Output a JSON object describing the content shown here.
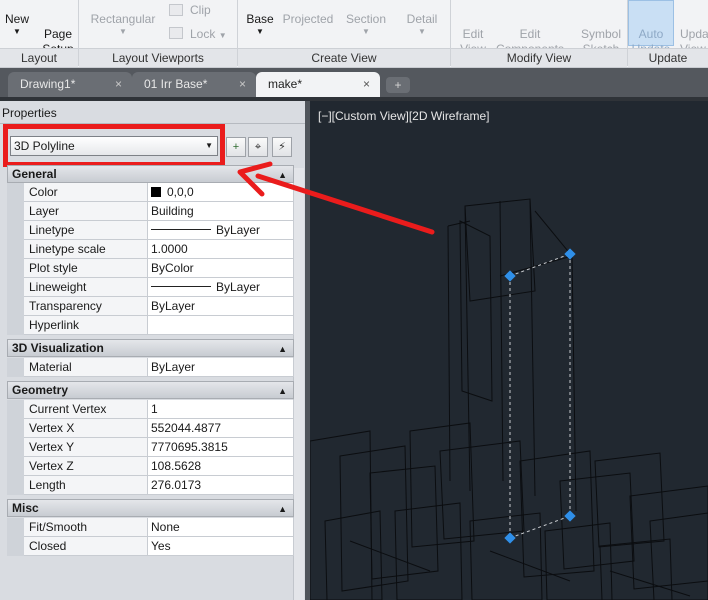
{
  "ribbon": {
    "layout_panel": {
      "new_label": "New",
      "page_setup_label": "Page\nSetup",
      "title": "Layout"
    },
    "viewports_panel": {
      "rectangular_label": "Rectangular",
      "clip_label": "Clip",
      "lock_label": "Lock",
      "title": "Layout Viewports"
    },
    "create_view_panel": {
      "base_label": "Base",
      "projected_label": "Projected",
      "section_label": "Section",
      "detail_label": "Detail",
      "title": "Create View"
    },
    "modify_view_panel": {
      "edit_view_label": "Edit\nView",
      "edit_components_label": "Edit\nComponents",
      "symbol_sketch_label": "Symbol\nSketch",
      "title": "Modify View"
    },
    "update_panel": {
      "auto_update_label": "Auto\nUpdate",
      "update_view_label": "Upda\nView",
      "title": "Update"
    }
  },
  "tabs": [
    {
      "label": "Drawing1*",
      "close": "×"
    },
    {
      "label": "01 Irr Base*",
      "close": "×"
    },
    {
      "label": "make*",
      "close": "×",
      "active": true
    }
  ],
  "properties": {
    "title": "Properties",
    "selected_object": "3D Polyline",
    "sections": {
      "general": {
        "title": "General",
        "rows": [
          {
            "name": "Color",
            "value": "0,0,0"
          },
          {
            "name": "Layer",
            "value": "Building"
          },
          {
            "name": "Linetype",
            "value": "ByLayer"
          },
          {
            "name": "Linetype scale",
            "value": "1.0000"
          },
          {
            "name": "Plot style",
            "value": "ByColor"
          },
          {
            "name": "Lineweight",
            "value": "ByLayer"
          },
          {
            "name": "Transparency",
            "value": "ByLayer"
          },
          {
            "name": "Hyperlink",
            "value": ""
          }
        ]
      },
      "visualization": {
        "title": "3D Visualization",
        "rows": [
          {
            "name": "Material",
            "value": "ByLayer"
          }
        ]
      },
      "geometry": {
        "title": "Geometry",
        "rows": [
          {
            "name": "Current Vertex",
            "value": "1"
          },
          {
            "name": "Vertex X",
            "value": "552044.4877"
          },
          {
            "name": "Vertex Y",
            "value": "7770695.3815"
          },
          {
            "name": "Vertex Z",
            "value": "108.5628"
          },
          {
            "name": "Length",
            "value": "276.0173"
          }
        ]
      },
      "misc": {
        "title": "Misc",
        "rows": [
          {
            "name": "Fit/Smooth",
            "value": "None"
          },
          {
            "name": "Closed",
            "value": "Yes"
          }
        ]
      }
    }
  },
  "viewport": {
    "label": "[−][Custom View][2D Wireframe]"
  },
  "colors": {
    "highlight": "#ea1c1c",
    "grip": "#2f8fe8",
    "viewport_bg": "#212830"
  }
}
